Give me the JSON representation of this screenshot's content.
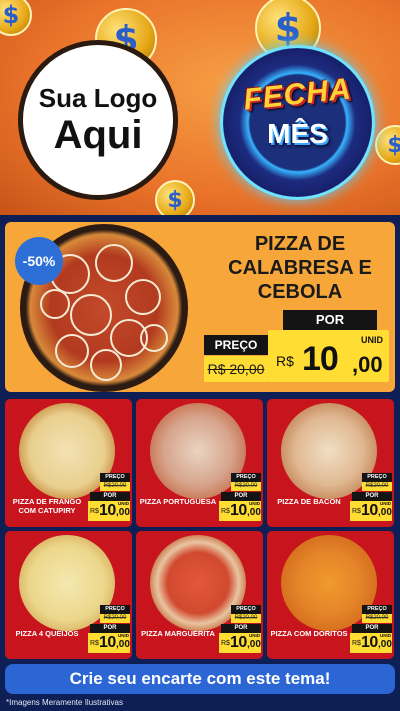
{
  "header": {
    "logo_line1": "Sua Logo",
    "logo_line2": "Aqui",
    "badge_word1": "FECHA",
    "badge_word2": "MÊS",
    "coin_symbol": "$"
  },
  "featured": {
    "discount": "-50%",
    "title": "PIZZA DE CALABRESA E CEBOLA",
    "por_label": "POR",
    "preco_label": "PREÇO",
    "old_price": "R$ 20,00",
    "currency": "R$",
    "price_int": "10",
    "price_cents": ",00",
    "unit": "UNID"
  },
  "products": [
    {
      "name": "PIZZA DE FRANGO COM CATUPIRY",
      "preco_label": "PREÇO",
      "old_price": "R$20,00",
      "por_label": "POR",
      "currency": "R$",
      "price_int": "10",
      "price_cents": ",00",
      "unit": "UNID"
    },
    {
      "name": "PIZZA PORTUGUESA",
      "preco_label": "PREÇO",
      "old_price": "R$20,00",
      "por_label": "POR",
      "currency": "R$",
      "price_int": "10",
      "price_cents": ",00",
      "unit": "UNID"
    },
    {
      "name": "PIZZA DE BACON",
      "preco_label": "PREÇO",
      "old_price": "R$20,00",
      "por_label": "POR",
      "currency": "R$",
      "price_int": "10",
      "price_cents": ",00",
      "unit": "UNID"
    },
    {
      "name": "PIZZA 4 QUEIJOS",
      "preco_label": "PREÇO",
      "old_price": "R$20,00",
      "por_label": "POR",
      "currency": "R$",
      "price_int": "10",
      "price_cents": ",00",
      "unit": "UNID"
    },
    {
      "name": "PIZZA MARGUERITA",
      "preco_label": "PREÇO",
      "old_price": "R$20,00",
      "por_label": "POR",
      "currency": "R$",
      "price_int": "10",
      "price_cents": ",00",
      "unit": "UNID"
    },
    {
      "name": "PIZZA COM DORITOS",
      "preco_label": "PREÇO",
      "old_price": "R$20,00",
      "por_label": "POR",
      "currency": "R$",
      "price_int": "10",
      "price_cents": ",00",
      "unit": "UNID"
    }
  ],
  "cta_label": "Crie seu encarte com este tema!",
  "disclaimer": "*Imagens Meramente Ilustrativas",
  "colors": {
    "background": "#0d1f55",
    "header_orange": "#e9732a",
    "featured_orange": "#f7a63a",
    "card_red": "#c8141c",
    "price_yellow": "#ffdd33",
    "discount_blue": "#2d6fd6",
    "cta_blue": "#2c66d4"
  }
}
